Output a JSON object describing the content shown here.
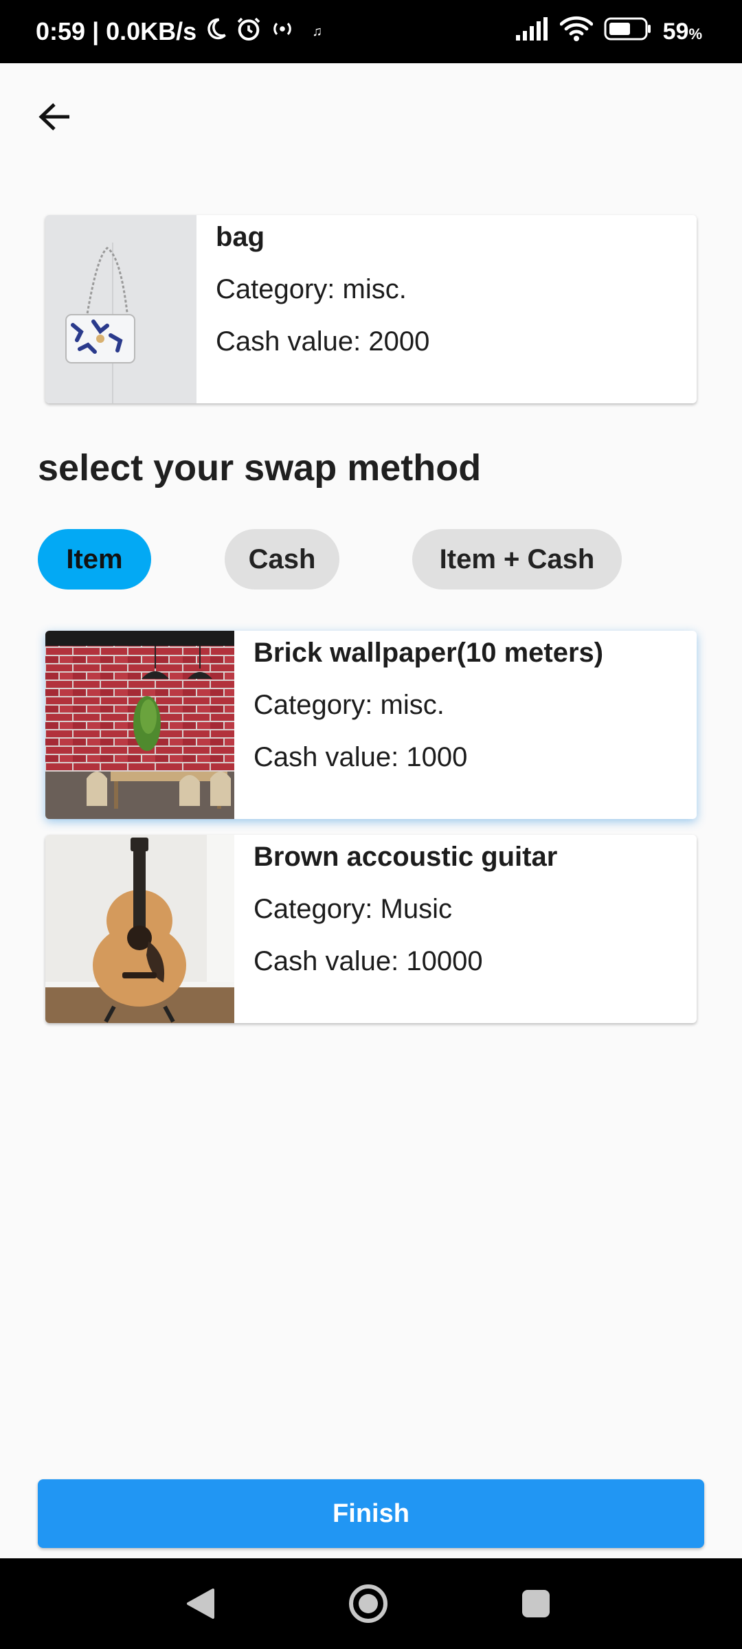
{
  "status_bar": {
    "time": "0:59",
    "network_speed": "| 0.0KB/s",
    "battery_value": "59",
    "battery_unit": "%"
  },
  "main_item": {
    "name": "bag",
    "category": "Category: misc.",
    "cash_value": "Cash value: 2000"
  },
  "heading": "select your swap method",
  "swap_methods": [
    {
      "label": "Item",
      "active": true
    },
    {
      "label": "Cash",
      "active": false
    },
    {
      "label": "Item + Cash",
      "active": false
    }
  ],
  "items": [
    {
      "name": "Brick wallpaper(10 meters)",
      "category": "Category: misc.",
      "cash_value": "Cash value: 1000"
    },
    {
      "name": "Brown accoustic guitar",
      "category": "Category: Music",
      "cash_value": "Cash value: 10000"
    }
  ],
  "finish_label": "Finish",
  "colors": {
    "accent": "#2196f3",
    "chip_active": "#03a9f4",
    "chip_inactive": "#e0e0e0"
  }
}
